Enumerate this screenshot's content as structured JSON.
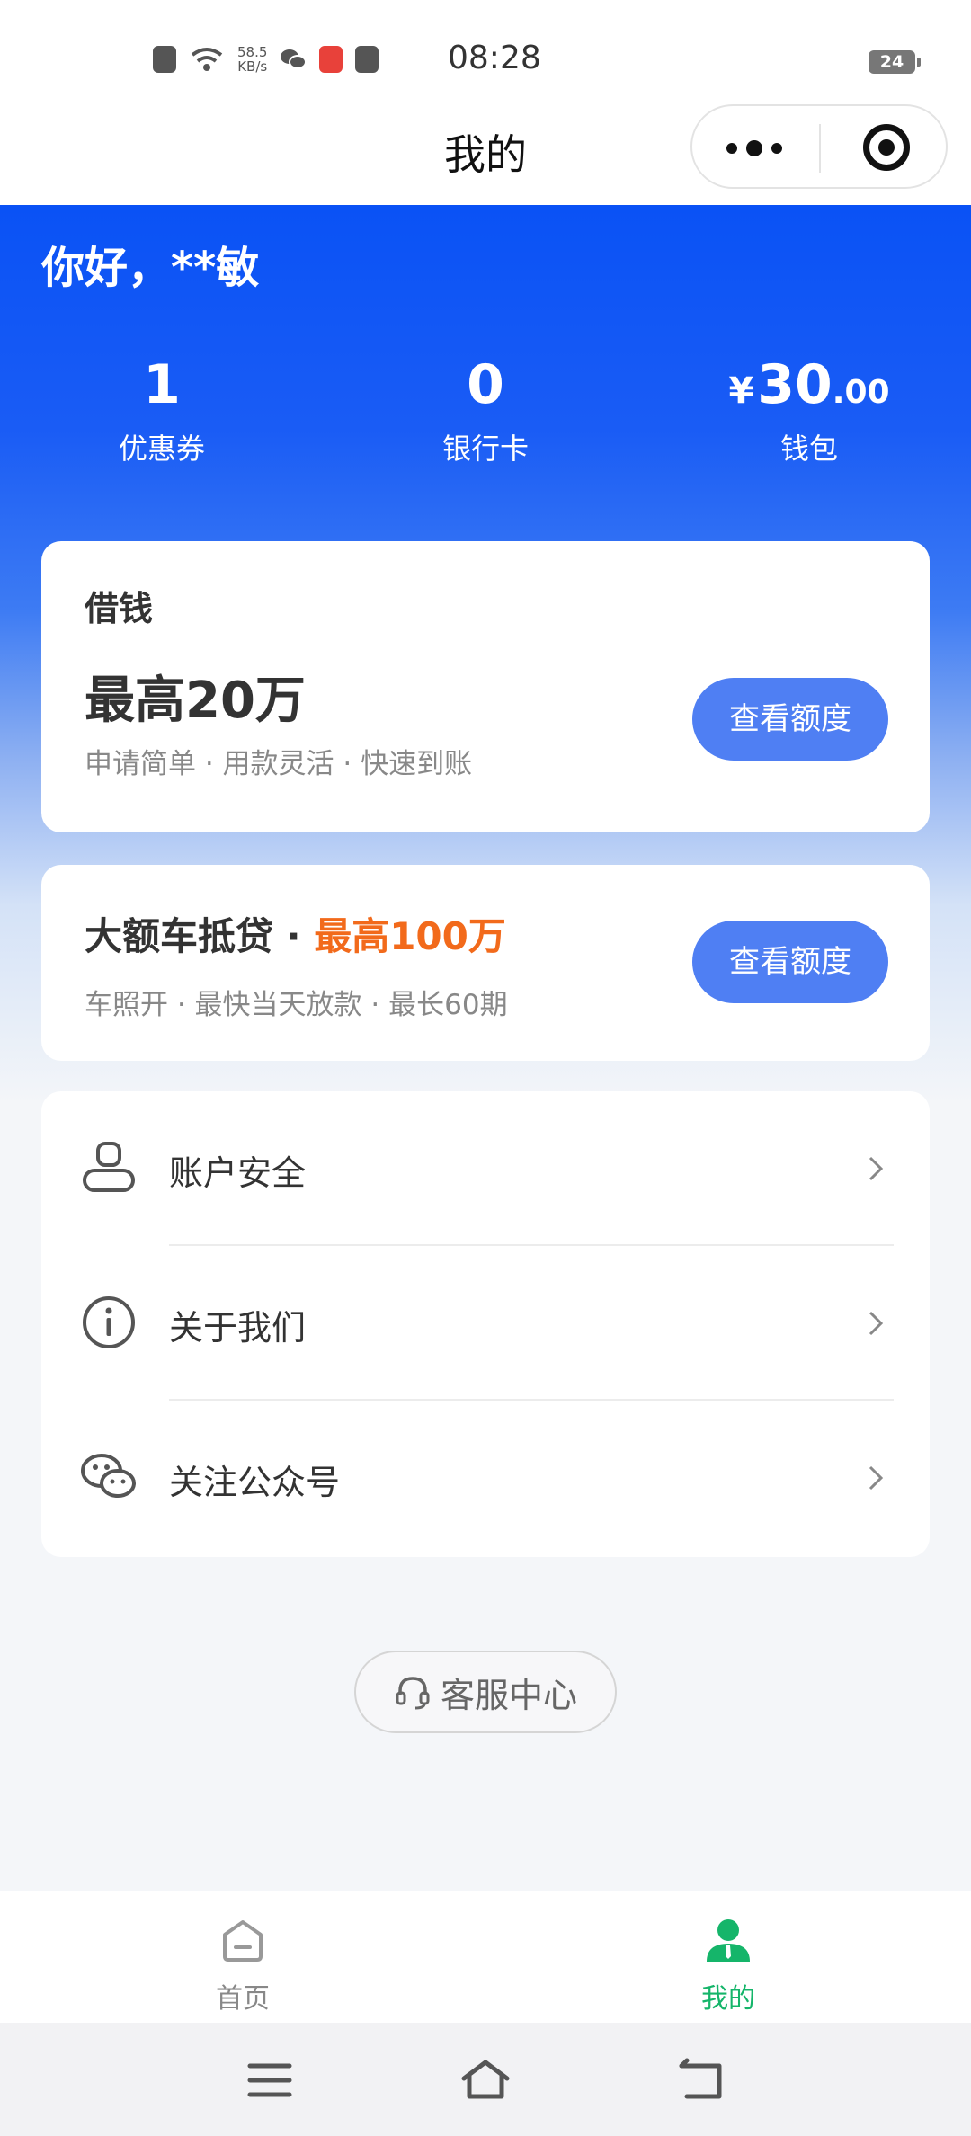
{
  "status_bar": {
    "net_speed_value": "58.5",
    "net_speed_unit": "KB/s",
    "time": "08:28",
    "battery": "24"
  },
  "nav": {
    "title": "我的"
  },
  "hero": {
    "greeting": "你好，**敏",
    "stats": [
      {
        "value": "1",
        "label": "优惠券"
      },
      {
        "value": "0",
        "label": "银行卡"
      },
      {
        "currency": "¥",
        "value_int": "30",
        "value_dec": ".00",
        "label": "钱包"
      }
    ]
  },
  "loan_card": {
    "title": "借钱",
    "amount": "最高20万",
    "description": "申请简单 · 用款灵活 · 快速到账",
    "button": "查看额度"
  },
  "car_loan_card": {
    "title": "大额车抵贷 · ",
    "highlight": "最高100万",
    "description": "车照开 · 最快当天放款 · 最长60期",
    "button": "查看额度",
    "highlight_color": "#f26a1b"
  },
  "menu": {
    "items": [
      {
        "label": "账户安全",
        "icon": "user-icon"
      },
      {
        "label": "关于我们",
        "icon": "info-icon"
      },
      {
        "label": "关注公众号",
        "icon": "wechat-icon"
      }
    ]
  },
  "service": {
    "label": "客服中心",
    "icon": "headset-icon"
  },
  "tabbar": {
    "tabs": [
      {
        "label": "首页",
        "icon": "home-icon",
        "active": false
      },
      {
        "label": "我的",
        "icon": "profile-icon",
        "active": true
      }
    ],
    "active_color": "#15b56a"
  },
  "colors": {
    "primary_blue": "#0a52f5",
    "button_blue": "#4f7ff3"
  }
}
